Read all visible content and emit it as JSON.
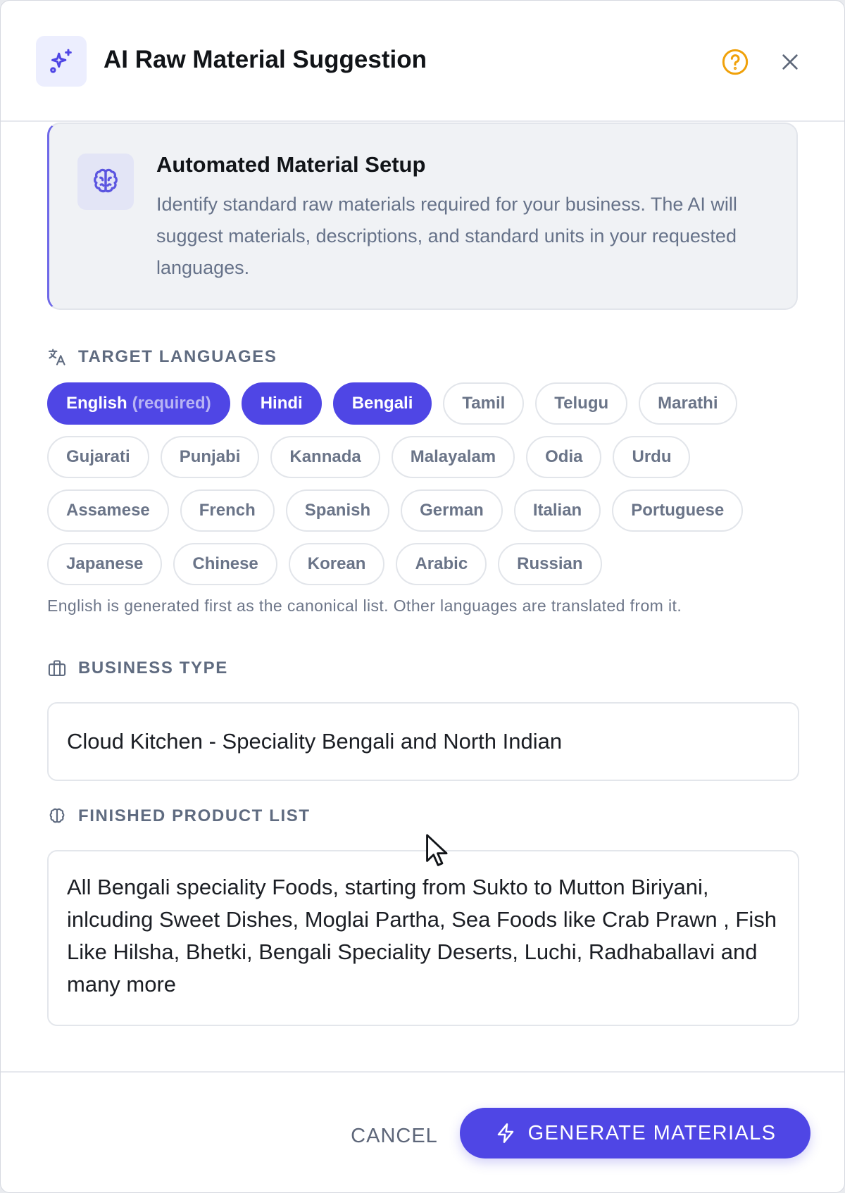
{
  "header": {
    "title": "AI Raw Material Suggestion",
    "icon": "sparkles-icon",
    "help_icon": "help-circle-icon",
    "close_icon": "close-icon"
  },
  "info_card": {
    "icon": "brain-icon",
    "title": "Automated Material Setup",
    "description": "Identify standard raw materials required for your business. The AI will suggest materials, descriptions, and standard units in your requested languages."
  },
  "languages": {
    "label": "TARGET LANGUAGES",
    "icon": "translate-icon",
    "required_suffix": "(required)",
    "rows": [
      [
        {
          "label": "English",
          "selected": true,
          "required": true
        },
        {
          "label": "Hindi",
          "selected": true
        },
        {
          "label": "Bengali",
          "selected": true
        },
        {
          "label": "Tamil",
          "selected": false
        },
        {
          "label": "Telugu",
          "selected": false
        },
        {
          "label": "Marathi",
          "selected": false
        }
      ],
      [
        {
          "label": "Gujarati",
          "selected": false
        },
        {
          "label": "Punjabi",
          "selected": false
        },
        {
          "label": "Kannada",
          "selected": false
        },
        {
          "label": "Malayalam",
          "selected": false
        },
        {
          "label": "Odia",
          "selected": false
        },
        {
          "label": "Urdu",
          "selected": false
        }
      ],
      [
        {
          "label": "Assamese",
          "selected": false
        },
        {
          "label": "French",
          "selected": false
        },
        {
          "label": "Spanish",
          "selected": false
        },
        {
          "label": "German",
          "selected": false
        },
        {
          "label": "Italian",
          "selected": false
        },
        {
          "label": "Portuguese",
          "selected": false
        }
      ],
      [
        {
          "label": "Japanese",
          "selected": false
        },
        {
          "label": "Chinese",
          "selected": false
        },
        {
          "label": "Korean",
          "selected": false
        },
        {
          "label": "Arabic",
          "selected": false
        },
        {
          "label": "Russian",
          "selected": false
        }
      ]
    ],
    "hint": "English is generated first as the canonical list. Other languages are translated from it."
  },
  "business_type": {
    "label": "BUSINESS TYPE",
    "icon": "briefcase-icon",
    "value": "Cloud Kitchen - Speciality Bengali and North Indian"
  },
  "finished_products": {
    "label": "FINISHED PRODUCT LIST",
    "icon": "brain-icon",
    "value": "All Bengali speciality Foods, starting from Sukto to Mutton Biriyani, inlcuding Sweet Dishes, Moglai Partha, Sea Foods like Crab Prawn , Fish Like Hilsha, Bhetki, Bengali Speciality Deserts, Luchi, Radhaballavi and many more"
  },
  "footer": {
    "cancel_label": "CANCEL",
    "generate_label": "GENERATE MATERIALS",
    "generate_icon": "lightning-icon"
  },
  "colors": {
    "accent": "#4f46e5",
    "help": "#f0a10a",
    "muted_text": "#667289"
  }
}
